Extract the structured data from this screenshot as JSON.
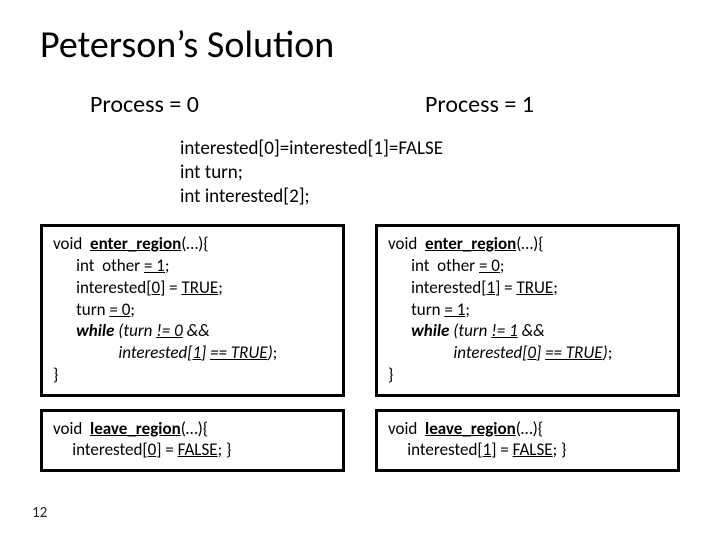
{
  "title": "Peterson’s Solution",
  "left_header": "Process = 0",
  "right_header": "Process = 1",
  "shared_l1": "interested[0]=interested[1]=FALSE",
  "shared_l2": "int turn;",
  "shared_l3": "int interested[2];",
  "left": {
    "enter": {
      "sig1": "void  ",
      "sig_decl": "enter_region",
      "sig2": "(…){",
      "l2a": "      int  other ",
      "l2b": "= 1",
      "l2c": ";",
      "l3a": "      interested[",
      "l3b": "0",
      "l3c": "] = ",
      "l3d": "TRUE",
      "l3e": ";",
      "l4a": "      turn ",
      "l4b": "= 0",
      "l4c": ";",
      "l5a": "      ",
      "l5b": "while",
      "l5c": " (turn ",
      "l5d": "!= 0",
      "l5e": " &&",
      "l6a": "                 interested[",
      "l6b": "1",
      "l6c": "] ",
      "l6d": "== TRUE",
      "l6e": ")",
      "l6f": ";",
      "close": "}"
    },
    "leave": {
      "sig1": "void  ",
      "sig_decl": "leave_region",
      "sig2": "(…){",
      "l2a": "     interested[",
      "l2b": "0",
      "l2c": "] = ",
      "l2d": "FALSE",
      "l2e": "; }"
    }
  },
  "right": {
    "enter": {
      "sig1": "void  ",
      "sig_decl": "enter_region",
      "sig2": "(…){",
      "l2a": "      int  other ",
      "l2b": "= 0",
      "l2c": ";",
      "l3a": "      interested[",
      "l3b": "1",
      "l3c": "] = ",
      "l3d": "TRUE",
      "l3e": ";",
      "l4a": "      turn ",
      "l4b": "= 1",
      "l4c": ";",
      "l5a": "      ",
      "l5b": "while",
      "l5c": " (turn ",
      "l5d": "!= 1",
      "l5e": " &&",
      "l6a": "                 interested[",
      "l6b": "0",
      "l6c": "] ",
      "l6d": "== TRUE",
      "l6e": ")",
      "l6f": ";",
      "close": "}"
    },
    "leave": {
      "sig1": "void  ",
      "sig_decl": "leave_region",
      "sig2": "(…){",
      "l2a": "     interested[",
      "l2b": "1",
      "l2c": "] = ",
      "l2d": "FALSE",
      "l2e": "; }"
    }
  },
  "page_number": "12"
}
